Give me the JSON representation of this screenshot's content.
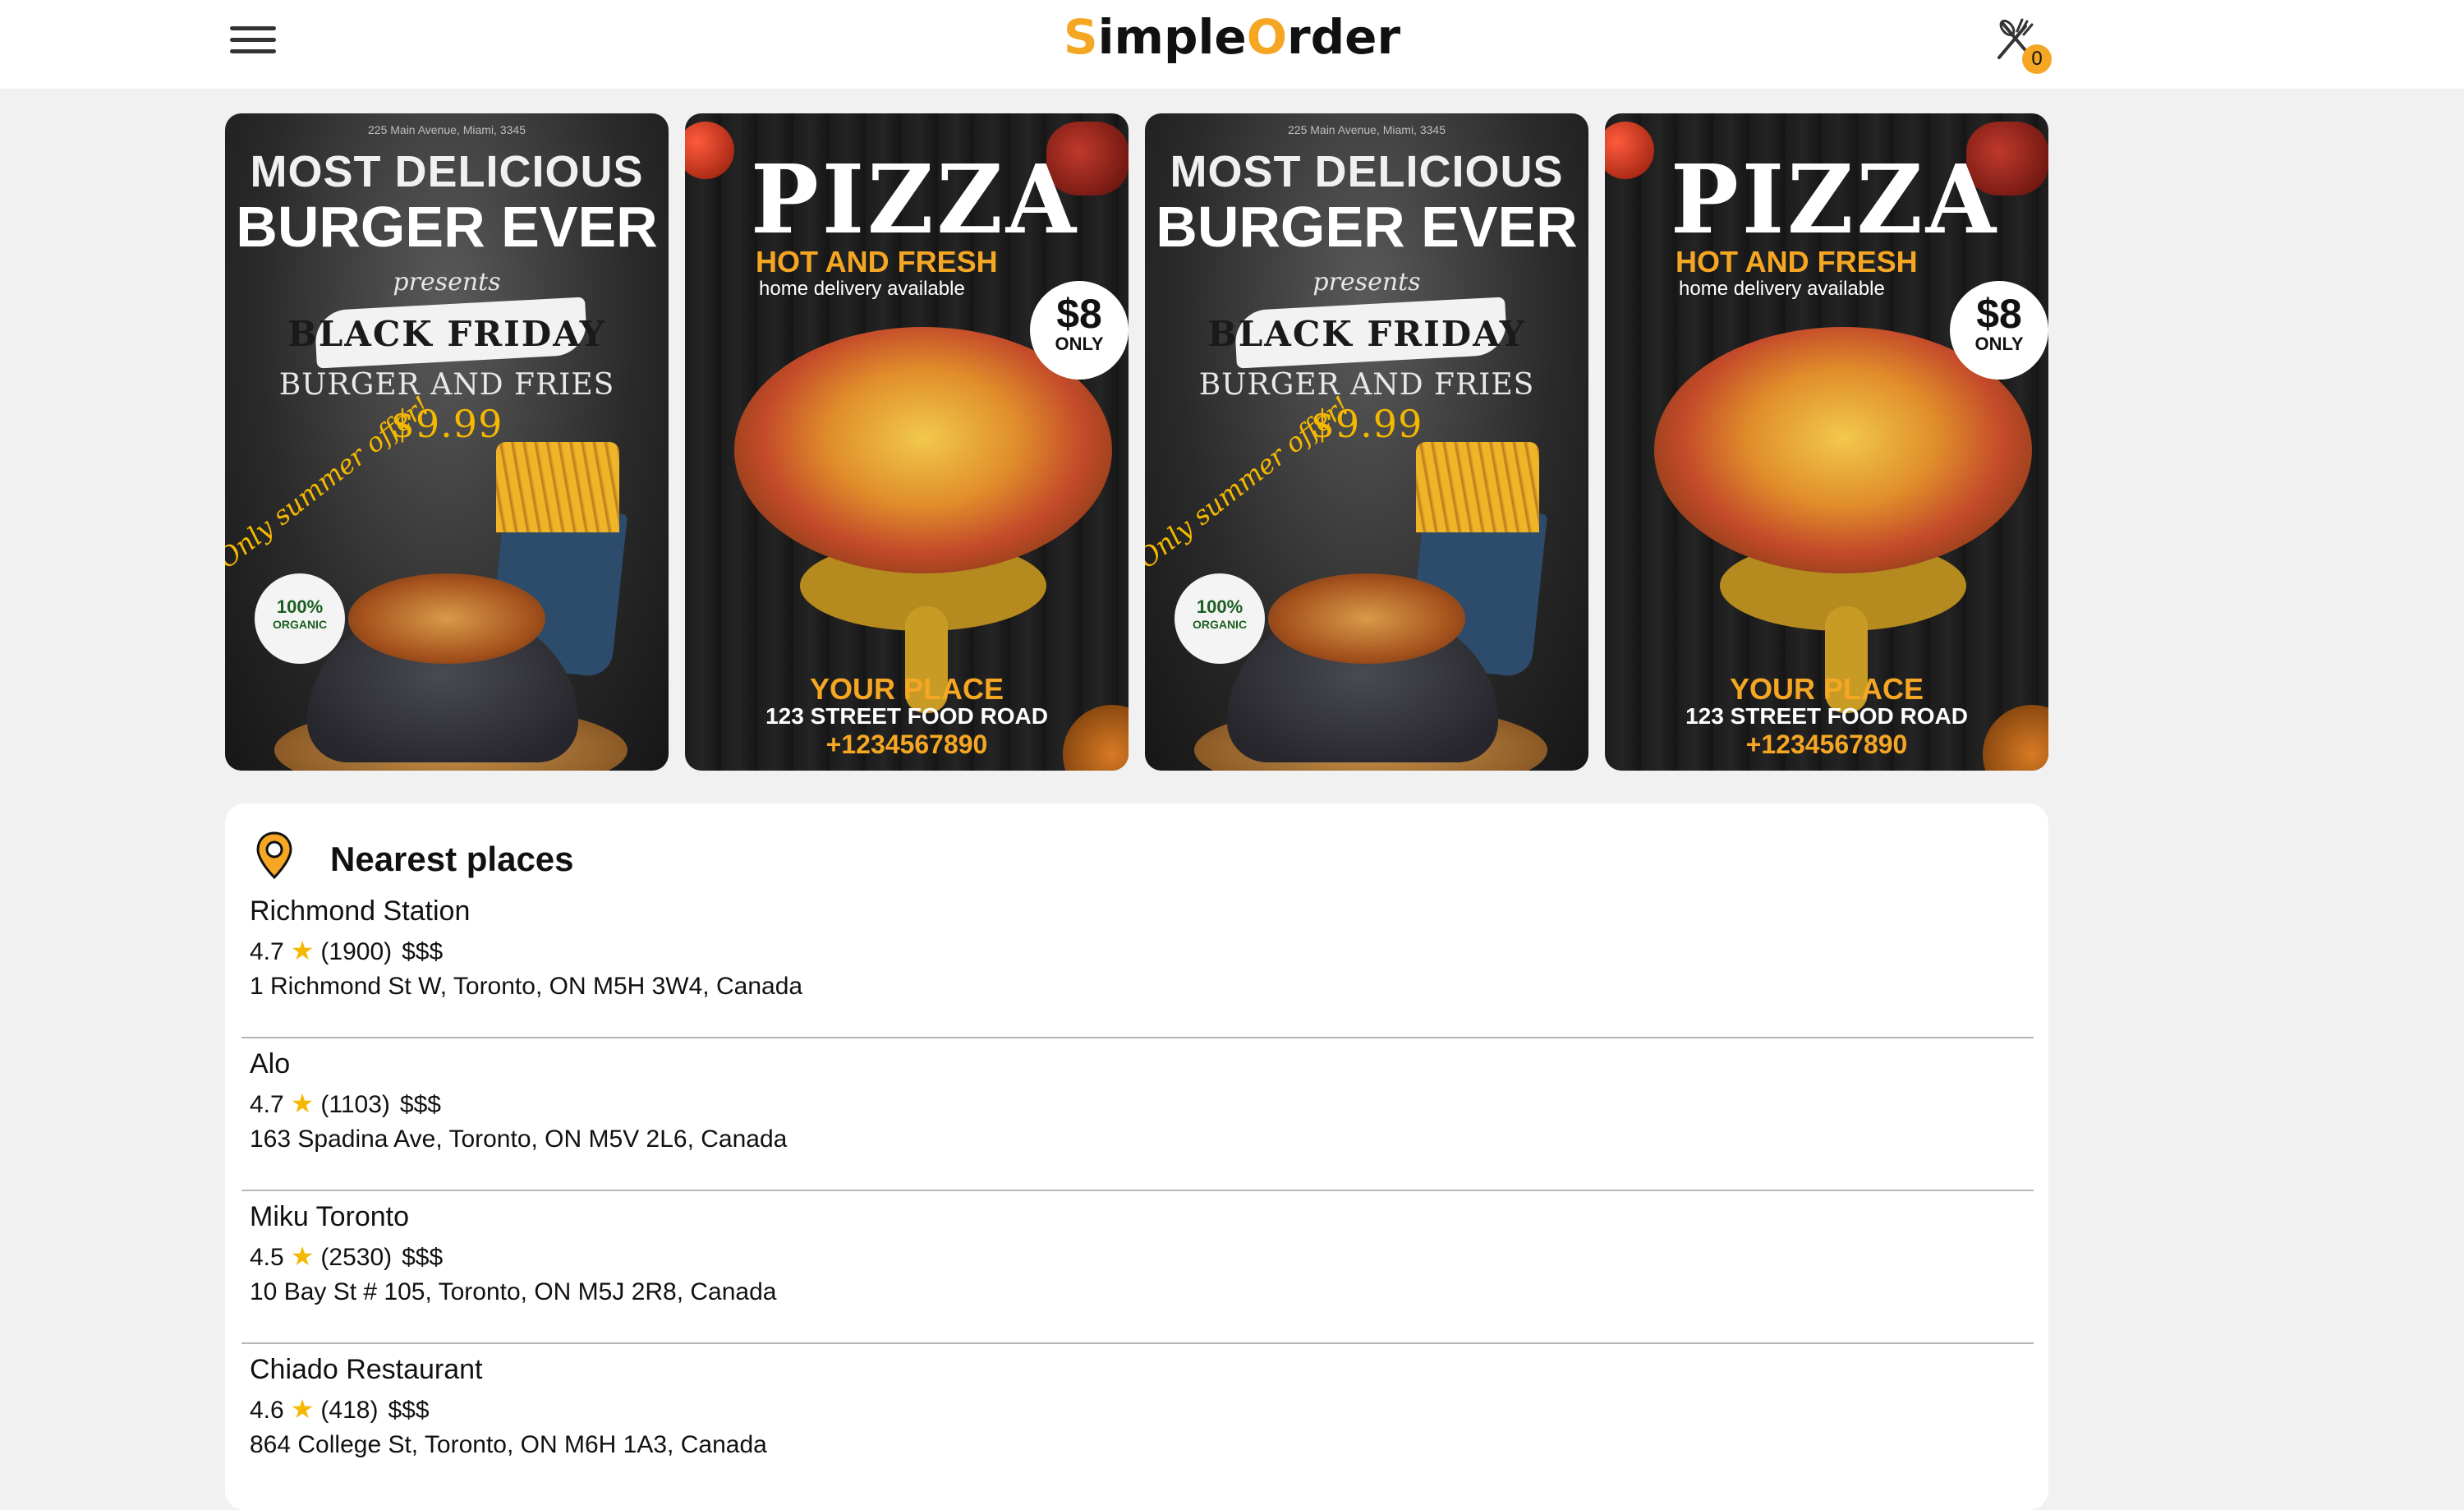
{
  "header": {
    "logo": {
      "s": "S",
      "part1": "imple",
      "o": "O",
      "part2": "rder"
    },
    "cart_count": "0",
    "colors": {
      "accent": "#f5a623",
      "text": "#111111",
      "background": "#f1f1f1"
    }
  },
  "banners": [
    {
      "type": "burger",
      "address": "225 Main Avenue, Miami, 3345",
      "headline1": "MOST DELICIOUS",
      "headline2": "BURGER EVER",
      "presents": "presents",
      "event": "BLACK FRIDAY",
      "deal_text": "BURGER AND FRIES",
      "deal_price": "$9.99",
      "offer": "Only summer offer!",
      "organic_pct": "100%",
      "organic_label": "ORGANIC"
    },
    {
      "type": "pizza",
      "title": "PIZZA",
      "tagline": "HOT AND FRESH",
      "sub": "home delivery available",
      "price": "$8",
      "price_note": "ONLY",
      "place": "YOUR PLACE",
      "street": "123 STREET FOOD ROAD",
      "phone": "+1234567890"
    },
    {
      "type": "burger",
      "address": "225 Main Avenue, Miami, 3345",
      "headline1": "MOST DELICIOUS",
      "headline2": "BURGER EVER",
      "presents": "presents",
      "event": "BLACK FRIDAY",
      "deal_text": "BURGER AND FRIES",
      "deal_price": "$9.99",
      "offer": "Only summer offer!",
      "organic_pct": "100%",
      "organic_label": "ORGANIC"
    },
    {
      "type": "pizza",
      "title": "PIZZA",
      "tagline": "HOT AND FRESH",
      "sub": "home delivery available",
      "price": "$8",
      "price_note": "ONLY",
      "place": "YOUR PLACE",
      "street": "123 STREET FOOD ROAD",
      "phone": "+1234567890"
    }
  ],
  "nearest": {
    "title": "Nearest places",
    "icon": "map-pin-icon",
    "places": [
      {
        "name": "Richmond Station",
        "rating": "4.7",
        "reviews": "(1900)",
        "price": "$$$",
        "address": "1 Richmond St W, Toronto, ON M5H 3W4, Canada"
      },
      {
        "name": "Alo",
        "rating": "4.7",
        "reviews": "(1103)",
        "price": "$$$",
        "address": "163 Spadina Ave, Toronto, ON M5V 2L6, Canada"
      },
      {
        "name": "Miku Toronto",
        "rating": "4.5",
        "reviews": "(2530)",
        "price": "$$$",
        "address": "10 Bay St # 105, Toronto, ON M5J 2R8, Canada"
      },
      {
        "name": "Chiado Restaurant",
        "rating": "4.6",
        "reviews": "(418)",
        "price": "$$$",
        "address": "864 College St, Toronto, ON M6H 1A3, Canada"
      }
    ]
  }
}
